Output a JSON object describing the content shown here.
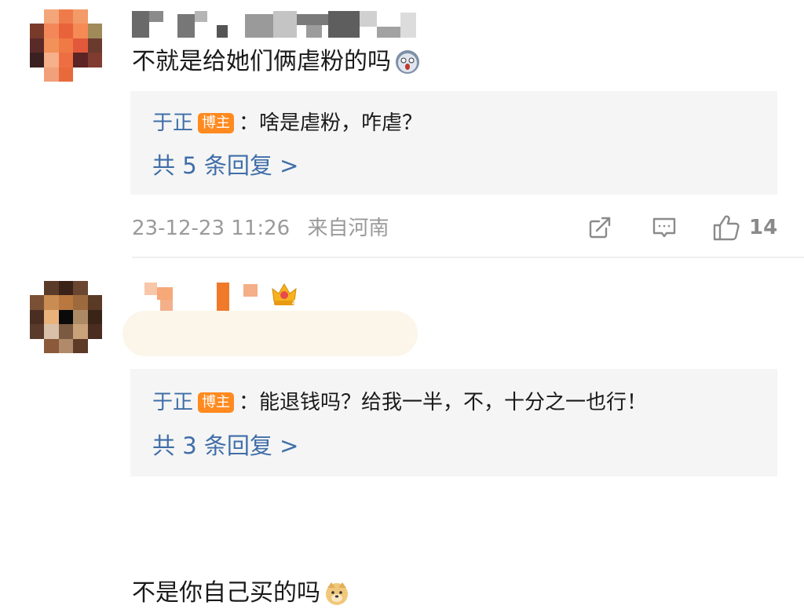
{
  "comments": [
    {
      "text": "不就是给她们俩虐粉的吗",
      "emoji_icon": "shocked-face-emoji",
      "reply": {
        "author": "于正",
        "badge": "博主",
        "text": "：啥是虐粉，咋虐？"
      },
      "reply_count_label": "共 5 条回复 >",
      "timestamp": "23-12-23 11:26",
      "location": "来自河南",
      "like_count": "14",
      "icons": [
        "share-icon",
        "comment-icon",
        "like-icon"
      ]
    },
    {
      "text": "不是你自己买的吗",
      "emoji_icon": "doge-emoji",
      "user_badge_icon": "crown-4-icon",
      "reply": {
        "author": "于正",
        "badge": "博主",
        "text": "：能退钱吗？给我一半，不，十分之一也行！"
      },
      "reply_count_label": "共 3 条回复 >"
    }
  ],
  "colors": {
    "link_blue": "#3f6ea8",
    "badge_orange": "#ff8a1f",
    "reply_bg": "#f5f5f5",
    "meta_gray": "#9a9a9a"
  }
}
